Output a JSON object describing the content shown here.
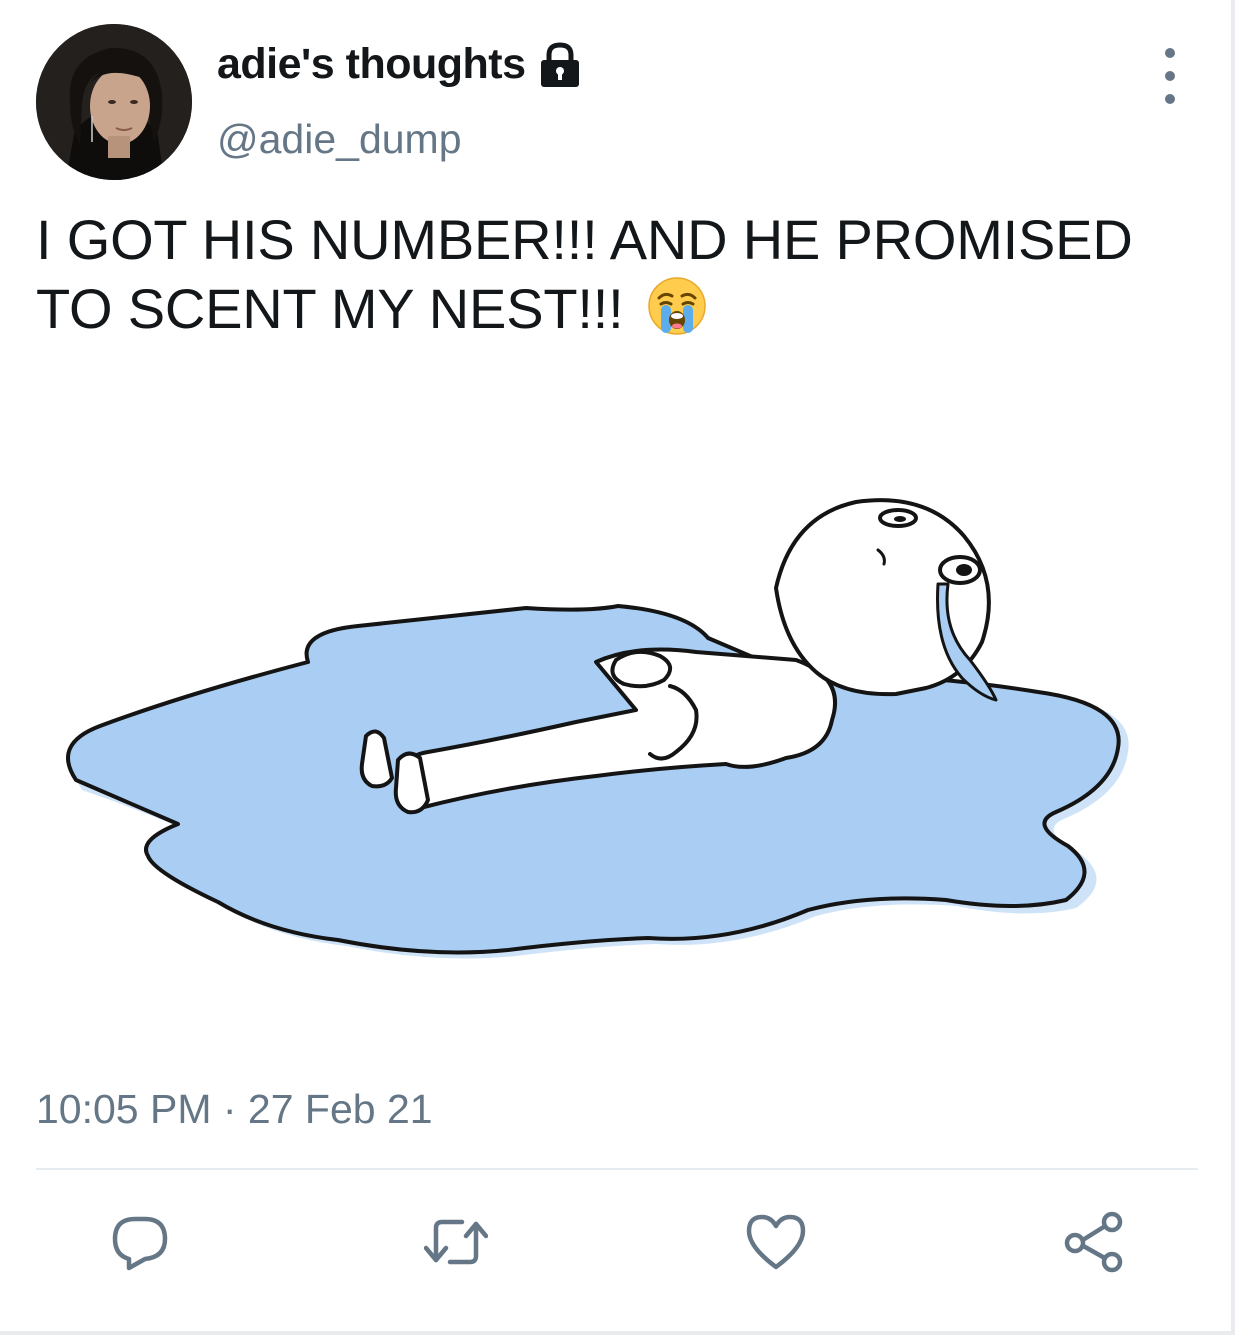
{
  "tweet": {
    "display_name": "adie's thoughts",
    "handle": "@adie_dump",
    "protected_icon": "lock-icon",
    "text": "I GOT HIS NUMBER!!! AND HE PROMISED TO SCENT MY NEST!!!",
    "emoji": "loudly-crying-face",
    "timestamp": "10:05 PM · 27 Feb 21"
  },
  "actions": [
    {
      "name": "reply",
      "icon": "reply-icon"
    },
    {
      "name": "retweet",
      "icon": "retweet-icon"
    },
    {
      "name": "like",
      "icon": "heart-icon"
    },
    {
      "name": "share",
      "icon": "share-icon"
    }
  ],
  "colors": {
    "text": "#14171a",
    "secondary": "#657786",
    "divider": "#e6ecf0",
    "puddle": "#a9cdf3"
  }
}
